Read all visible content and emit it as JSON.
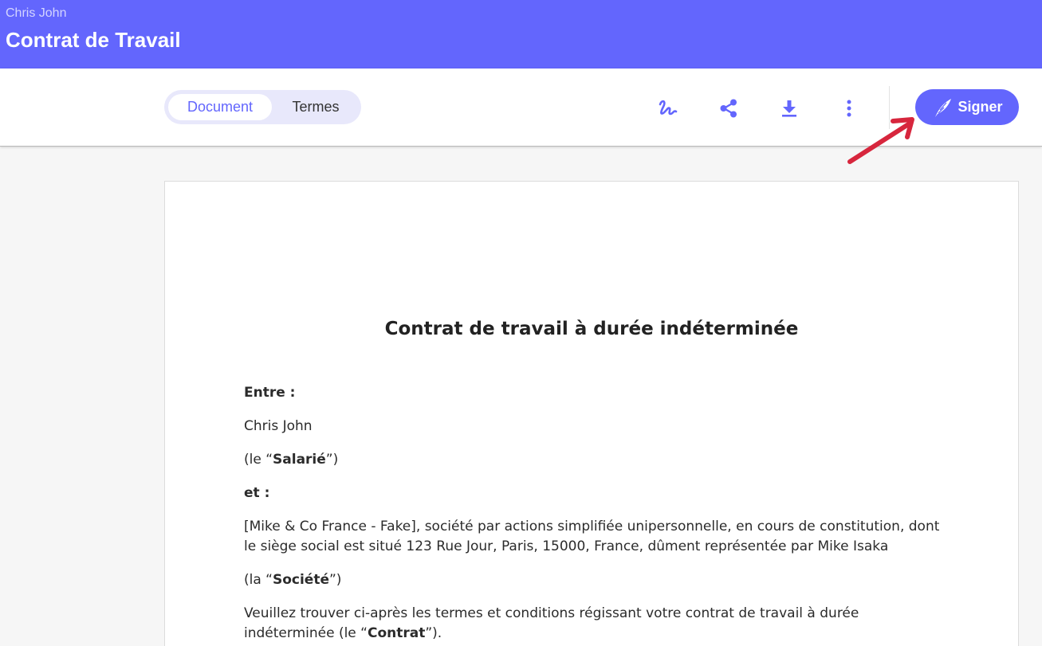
{
  "header": {
    "user_name": "Chris John",
    "title": "Contrat de Travail",
    "background_color": "#6366fd"
  },
  "toolbar": {
    "tabs": [
      {
        "label": "Document",
        "active": true
      },
      {
        "label": "Termes",
        "active": false
      }
    ],
    "icons": [
      "signature-icon",
      "share-icon",
      "download-icon",
      "more-vertical-icon"
    ],
    "sign_label": "Signer",
    "accent_color": "#6366fd"
  },
  "document": {
    "heading": "Contrat de travail à durée indéterminée",
    "entre_label": "Entre :",
    "employee_name": "Chris John",
    "employee_role_prefix": "(le “",
    "employee_role": "Salarié",
    "employee_role_suffix": "”)",
    "et_label": "et :",
    "company_description": "[Mike & Co France - Fake], société par actions simplifiée unipersonnelle, en cours de constitution, dont le siège social est situé 123 Rue Jour, Paris, 15000, France, dûment représentée par Mike Isaka",
    "company_role_prefix": "(la “",
    "company_role": "Société",
    "company_role_suffix": "”)",
    "intro_text": "Veuillez trouver ci-après les termes et conditions régissant votre contrat de travail à durée indéterminée (le “",
    "contract_word": "Contrat",
    "intro_suffix": "”)."
  },
  "annotation": {
    "arrow_color": "#d7263d"
  }
}
